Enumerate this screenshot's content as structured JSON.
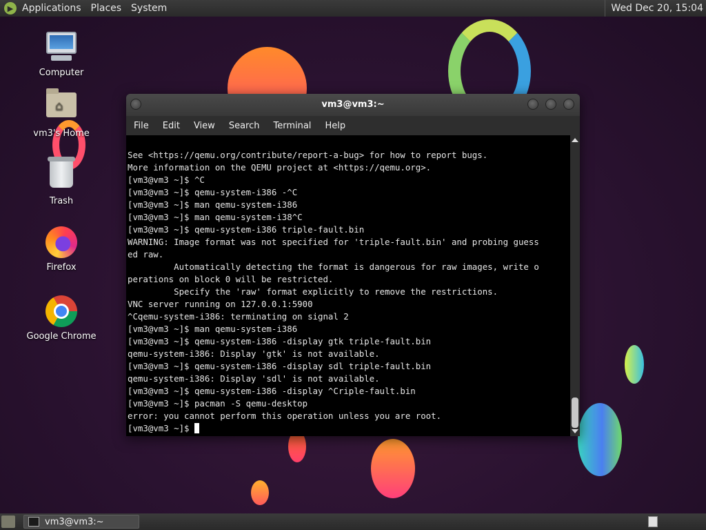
{
  "top_panel": {
    "menus": [
      "Applications",
      "Places",
      "System"
    ],
    "clock": "Wed Dec 20, 15:04"
  },
  "desktop_icons": [
    {
      "label": "Computer",
      "icon": "computer-icon"
    },
    {
      "label": "vm3's Home",
      "icon": "home-folder-icon"
    },
    {
      "label": "Trash",
      "icon": "trash-icon"
    },
    {
      "label": "Firefox",
      "icon": "firefox-icon"
    },
    {
      "label": "Google Chrome",
      "icon": "chrome-icon"
    }
  ],
  "terminal": {
    "title": "vm3@vm3:~",
    "menu": [
      "File",
      "Edit",
      "View",
      "Search",
      "Terminal",
      "Help"
    ],
    "lines": [
      "See <https://qemu.org/contribute/report-a-bug> for how to report bugs.",
      "More information on the QEMU project at <https://qemu.org>.",
      "[vm3@vm3 ~]$ ^C",
      "[vm3@vm3 ~]$ qemu-system-i386 -^C",
      "[vm3@vm3 ~]$ man qemu-system-i386",
      "[vm3@vm3 ~]$ man qemu-system-i38^C",
      "[vm3@vm3 ~]$ qemu-system-i386 triple-fault.bin",
      "WARNING: Image format was not specified for 'triple-fault.bin' and probing guess",
      "ed raw.",
      "         Automatically detecting the format is dangerous for raw images, write o",
      "perations on block 0 will be restricted.",
      "         Specify the 'raw' format explicitly to remove the restrictions.",
      "VNC server running on 127.0.0.1:5900",
      "^Cqemu-system-i386: terminating on signal 2",
      "[vm3@vm3 ~]$ man qemu-system-i386",
      "[vm3@vm3 ~]$ qemu-system-i386 -display gtk triple-fault.bin",
      "qemu-system-i386: Display 'gtk' is not available.",
      "[vm3@vm3 ~]$ qemu-system-i386 -display sdl triple-fault.bin",
      "qemu-system-i386: Display 'sdl' is not available.",
      "[vm3@vm3 ~]$ qemu-system-i386 -display ^Criple-fault.bin",
      "[vm3@vm3 ~]$ pacman -S qemu-desktop",
      "error: you cannot perform this operation unless you are root."
    ],
    "prompt": "[vm3@vm3 ~]$ "
  },
  "taskbar": {
    "task_label": "vm3@vm3:~"
  }
}
